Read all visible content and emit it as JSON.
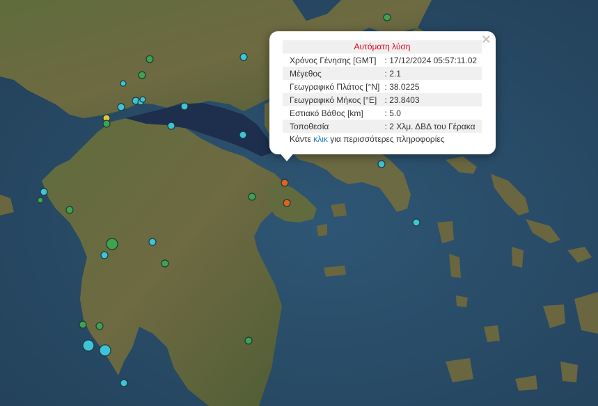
{
  "popup": {
    "title": "Αυτόματη λύση",
    "rows": [
      {
        "label": "Χρόνος Γένησης [GMT]",
        "value": ": 17/12/2024 05:57:11.02"
      },
      {
        "label": "Μέγεθος",
        "value": ": 2.1"
      },
      {
        "label": "Γεωγραφικό Πλάτος [°N]",
        "value": ": 38.0225"
      },
      {
        "label": "Γεωγραφικό Μήκος [°E]",
        "value": ": 23.8403"
      },
      {
        "label": "Εστιακό Βάθος [km]",
        "value": ": 5.0"
      },
      {
        "label": "Τοποθεσία",
        "value": ": 2 Χλμ. ΔΒΔ του Γέρακα"
      }
    ],
    "more_prefix": "Κάντε ",
    "more_link": "κλικ",
    "more_suffix": " για περισσότερες πληροφορίες",
    "close_glyph": "×"
  },
  "colors": {
    "sea": "#2b4f6b",
    "land": "#5b6a3a",
    "cyan_marker": "#3fc3d9",
    "green_marker": "#3fa34d",
    "orange_marker": "#e0641b",
    "yellow_marker": "#e8c53a",
    "popup_title": "#e0001a",
    "link": "#1a7fc4"
  },
  "markers": {
    "count": 40,
    "legend_note": "earthquake epicenters"
  }
}
